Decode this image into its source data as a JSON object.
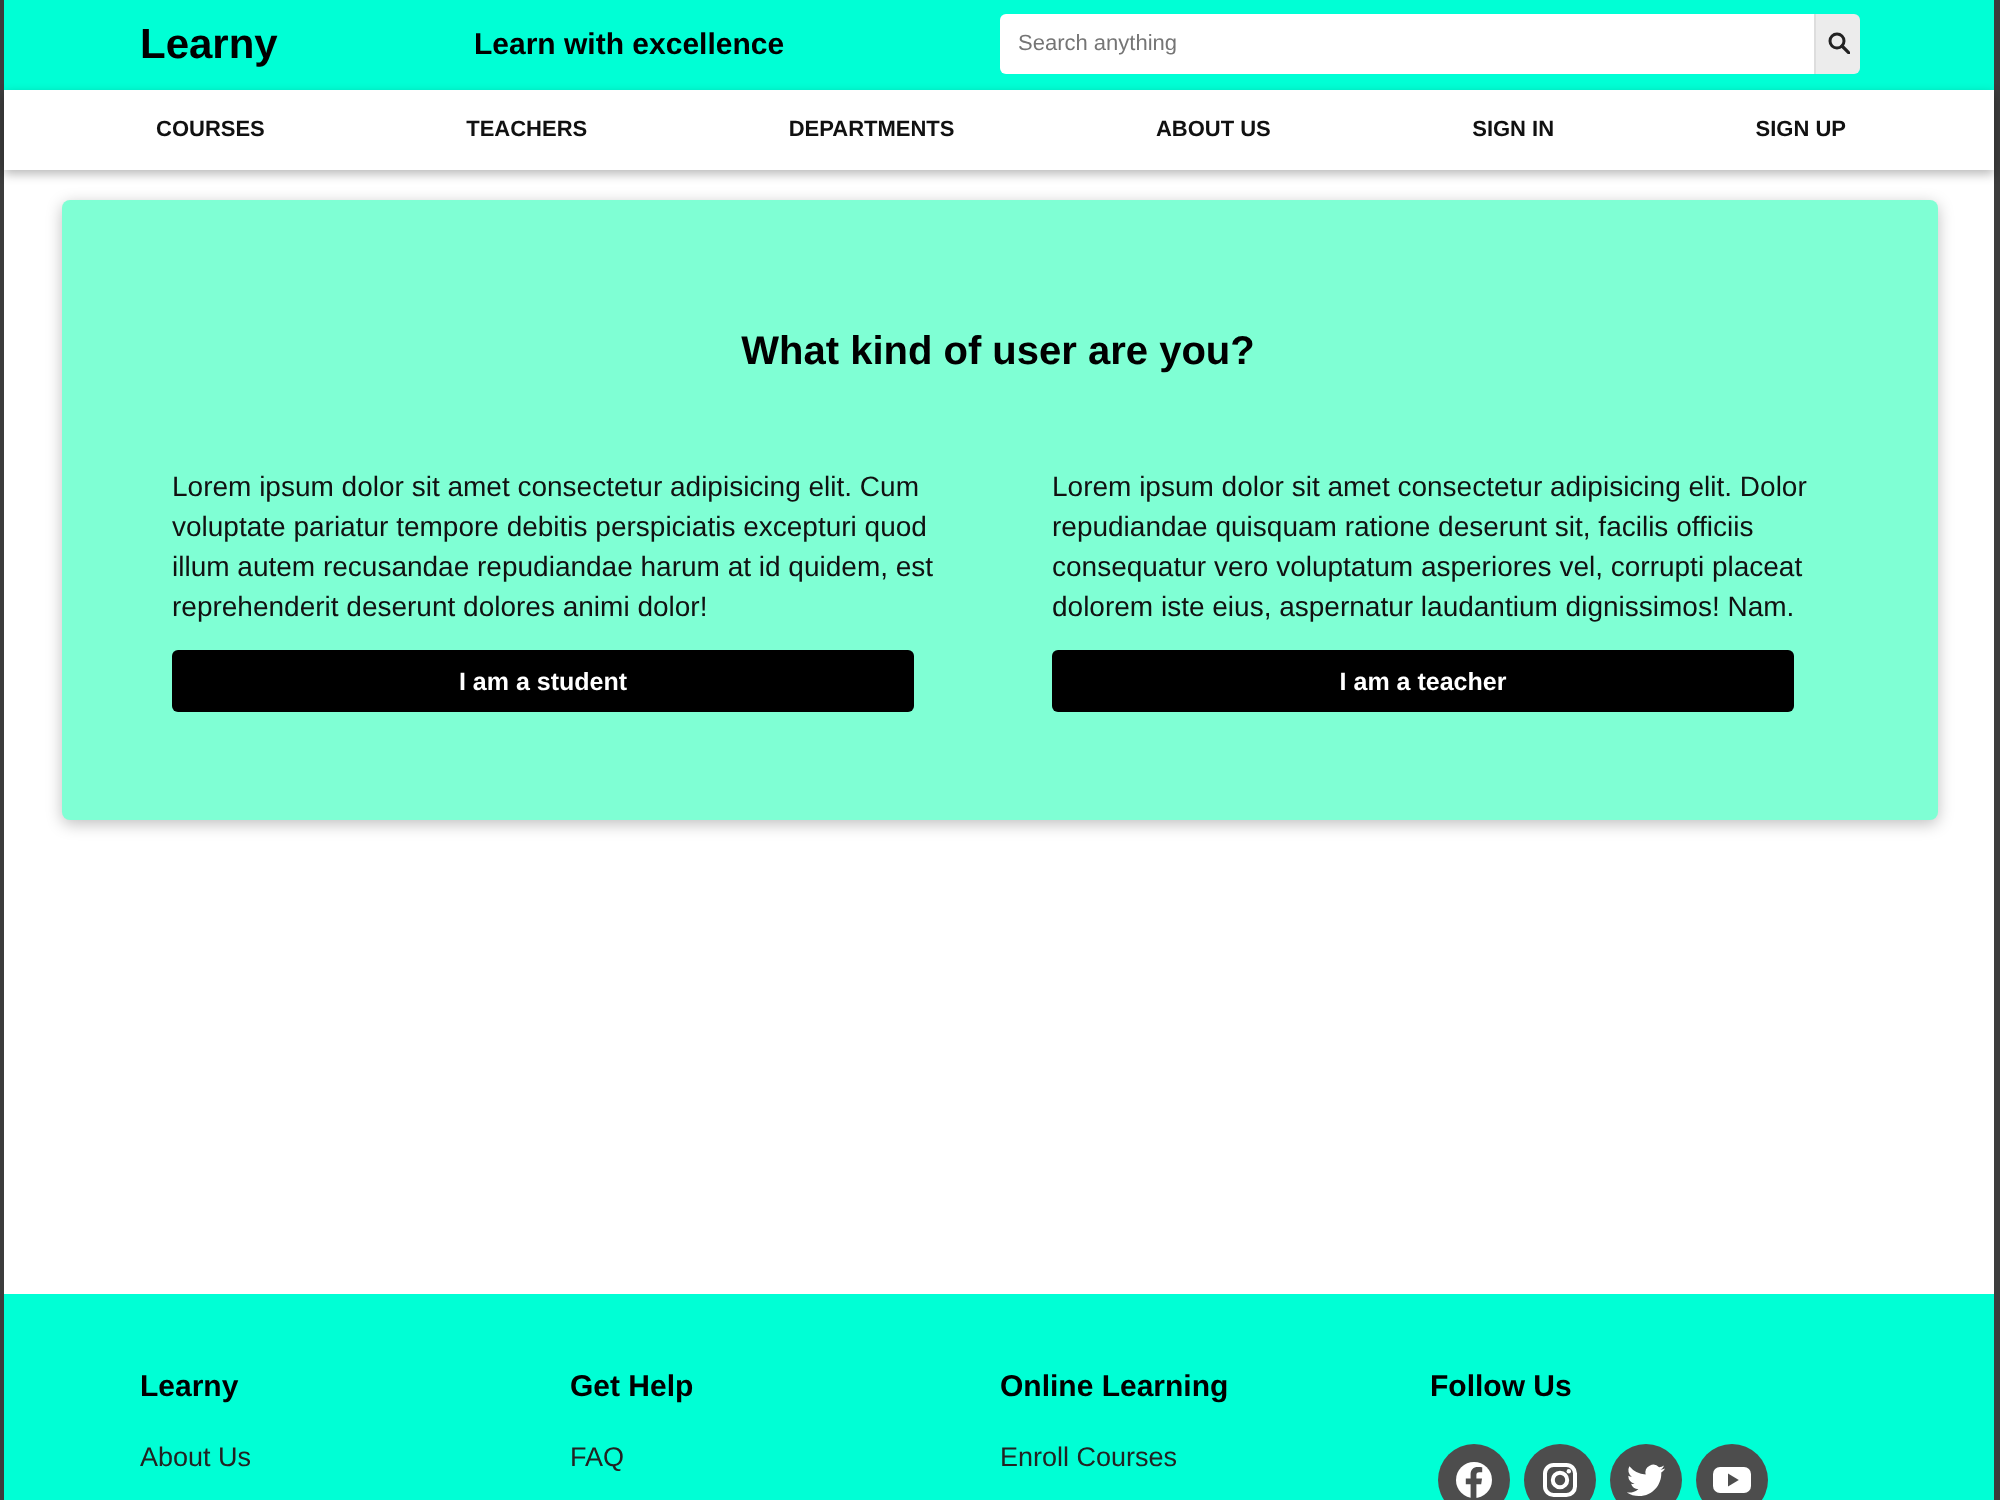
{
  "header": {
    "logo": "Learny",
    "tagline": "Learn with excellence",
    "search": {
      "placeholder": "Search anything"
    }
  },
  "nav": {
    "items": [
      "COURSES",
      "TEACHERS",
      "DEPARTMENTS",
      "ABOUT US",
      "SIGN IN",
      "SIGN UP"
    ]
  },
  "card": {
    "title": "What kind of user are you?",
    "options": [
      {
        "text": "Lorem ipsum dolor sit amet consectetur adipisicing elit. Cum voluptate pariatur tempore debitis perspiciatis excepturi quod illum autem recusandae repudiandae harum at id quidem, est reprehenderit deserunt dolores animi dolor!",
        "button": "I am a student"
      },
      {
        "text": "Lorem ipsum dolor sit amet consectetur adipisicing elit. Dolor repudiandae quisquam ratione deserunt sit, facilis officiis consequatur vero voluptatum asperiores vel, corrupti placeat dolorem iste eius, aspernatur laudantium dignissimos! Nam.",
        "button": "I am a teacher"
      }
    ]
  },
  "footer": {
    "columns": [
      {
        "kind": "links",
        "heading": "Learny",
        "links": [
          "About Us"
        ]
      },
      {
        "kind": "links",
        "heading": "Get Help",
        "links": [
          "FAQ"
        ]
      },
      {
        "kind": "links",
        "heading": "Online Learning",
        "links": [
          "Enroll Courses"
        ]
      },
      {
        "kind": "social",
        "heading": "Follow Us"
      }
    ]
  }
}
